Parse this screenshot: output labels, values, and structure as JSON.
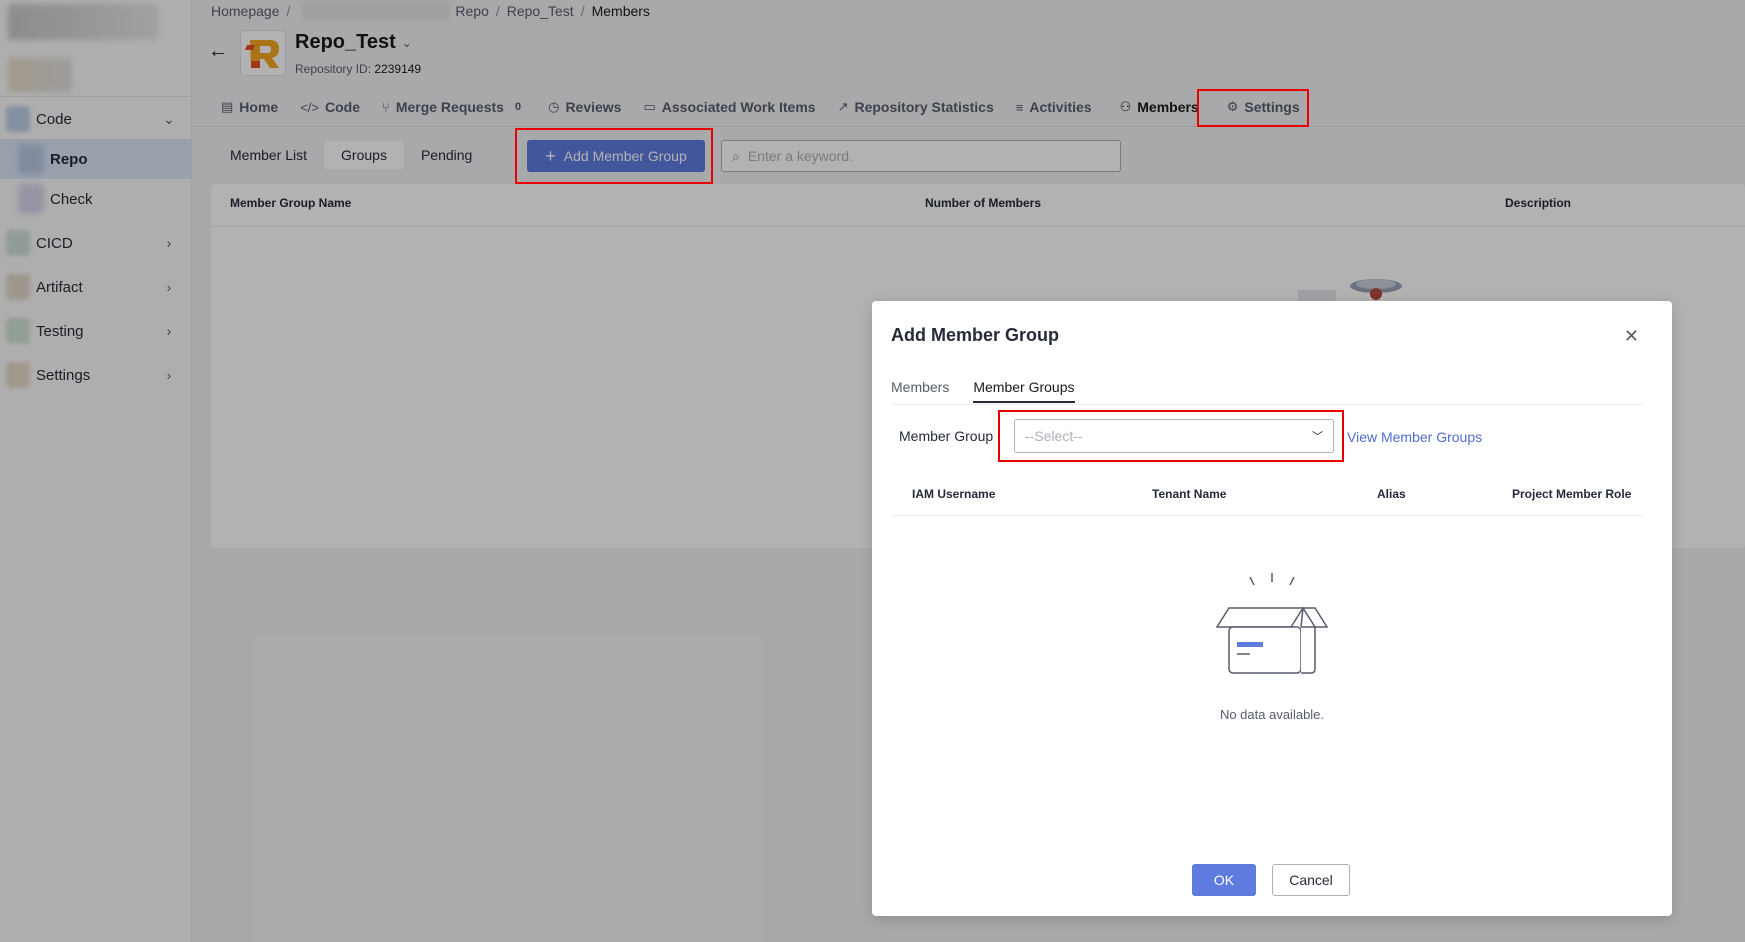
{
  "sidebar": {
    "items": [
      {
        "label": "Code",
        "expanded": true,
        "children": [
          {
            "label": "Repo",
            "active": true
          },
          {
            "label": "Check"
          }
        ]
      },
      {
        "label": "CICD"
      },
      {
        "label": "Artifact"
      },
      {
        "label": "Testing"
      },
      {
        "label": "Settings"
      }
    ]
  },
  "breadcrumb": {
    "home": "Homepage",
    "repo": "Repo",
    "repo_name": "Repo_Test",
    "current": "Members"
  },
  "repo": {
    "name": "Repo_Test",
    "id_label": "Repository ID:",
    "id_value": "2239149"
  },
  "tabs": [
    {
      "label": "Home",
      "icon": "home-icon"
    },
    {
      "label": "Code",
      "icon": "code-icon"
    },
    {
      "label": "Merge Requests",
      "icon": "merge-icon",
      "badge": "0"
    },
    {
      "label": "Reviews",
      "icon": "review-icon"
    },
    {
      "label": "Associated Work Items",
      "icon": "work-item-icon"
    },
    {
      "label": "Repository Statistics",
      "icon": "stats-icon"
    },
    {
      "label": "Activities",
      "icon": "list-icon"
    },
    {
      "label": "Members",
      "icon": "user-icon",
      "active": true
    },
    {
      "label": "Settings",
      "icon": "gear-icon"
    }
  ],
  "toolbar": {
    "segments": [
      "Member List",
      "Groups",
      "Pending"
    ],
    "active_segment": "Groups",
    "add_button": "Add Member Group",
    "search_placeholder": "Enter a keyword."
  },
  "table": {
    "columns": [
      "Member Group Name",
      "Number of Members",
      "Description"
    ]
  },
  "modal": {
    "title": "Add Member Group",
    "tabs": [
      "Members",
      "Member Groups"
    ],
    "active_tab": "Member Groups",
    "field_label": "Member Group",
    "select_placeholder": "--Select--",
    "view_link": "View Member Groups",
    "columns": [
      "IAM Username",
      "Tenant Name",
      "Alias",
      "Project Member Role"
    ],
    "empty_text": "No data available.",
    "ok": "OK",
    "cancel": "Cancel"
  },
  "colors": {
    "primary": "#5e7ce0",
    "highlight": "#e60000",
    "link": "#526ecc"
  }
}
